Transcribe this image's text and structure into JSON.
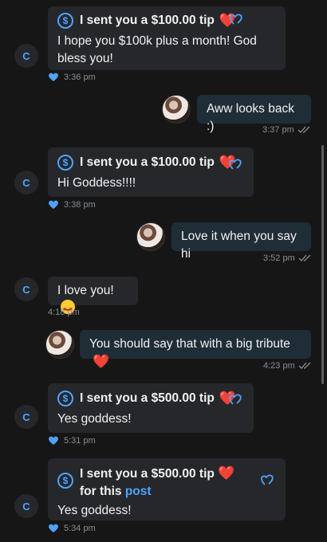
{
  "colors": {
    "background": "#161616",
    "incoming_bubble": "#26272b",
    "outgoing_bubble": "#1f2d37",
    "accent": "#4da3ff",
    "heart": "#e0262e"
  },
  "messages": [
    {
      "tip_text": "I sent you a $100.00 tip",
      "body": "I hope you $100k plus a month! God bless you!",
      "time": "3:36 pm"
    },
    {
      "body": "Aww looks back :)",
      "time": "3:37 pm"
    },
    {
      "tip_text": "I sent you a $100.00 tip",
      "body": "Hi Goddess!!!!",
      "time": "3:38 pm"
    },
    {
      "body": "Love it when you say hi",
      "time": "3:52 pm"
    },
    {
      "body": "I love you!",
      "time": "4:18 pm"
    },
    {
      "body": "You should say that with a big tribute",
      "time": "4:23 pm"
    },
    {
      "tip_text": "I sent you a $500.00 tip",
      "body": "Yes goddess!",
      "time": "5:31 pm"
    },
    {
      "tip_text": "I sent you a $500.00 tip",
      "tip_suffix": "for this",
      "link": "post",
      "body": "Yes goddess!",
      "time": "5:34 pm"
    }
  ],
  "avatar_initial": "C",
  "dollar_symbol": "$",
  "heart_symbol": "❤️",
  "icons": [
    "dollar-circle-icon",
    "heart-icon",
    "double-heart-icon",
    "like-heart-icon",
    "read-checks-icon",
    "heart-eyes-emoji"
  ]
}
